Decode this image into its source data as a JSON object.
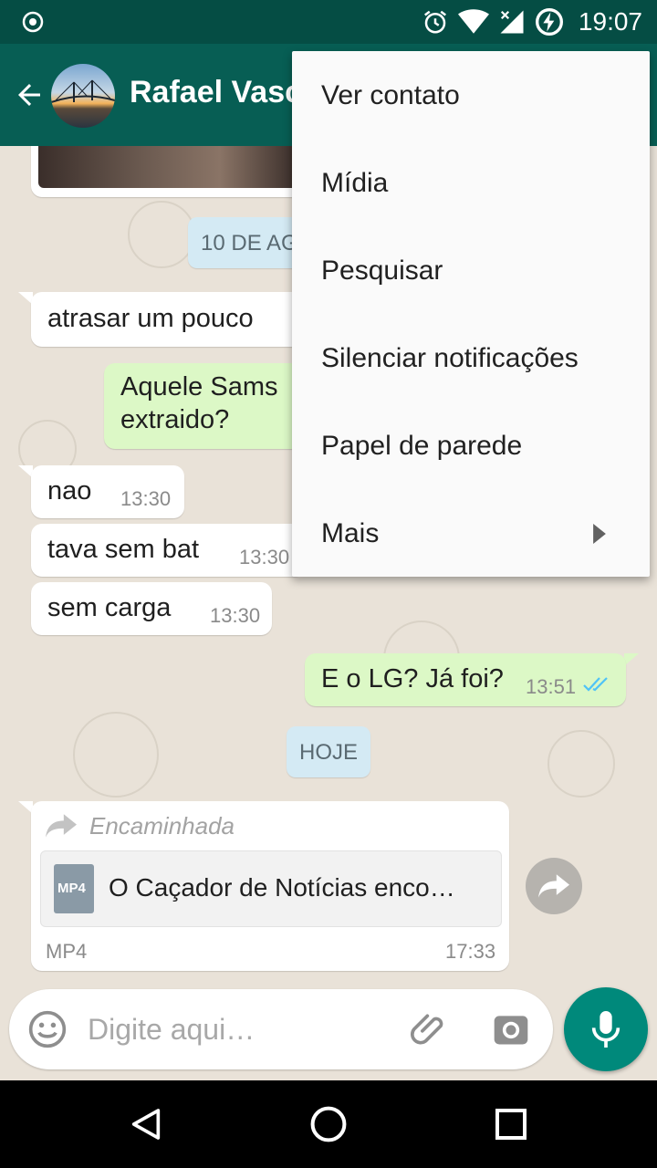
{
  "status_bar": {
    "time": "19:07"
  },
  "header": {
    "contact_name": "Rafael Vasc"
  },
  "messages": {
    "date_1": "10 DE AG",
    "m1_text": "atrasar um pouco",
    "m2_line1": "Aquele Sams",
    "m2_line2": "extraido?",
    "m3_text": "nao",
    "m3_time": "13:30",
    "m4_text": "tava sem bat",
    "m4_time": "13:30",
    "m5_text": "sem carga",
    "m5_time": "13:30",
    "m6_text": "E o LG? Já foi?",
    "m6_time": "13:51",
    "date_2": "HOJE",
    "forward_label": "Encaminhada",
    "file_icon_label": "MP4",
    "file_name": "O Caçador de Notícias enco…",
    "file_type": "MP4",
    "file_time": "17:33"
  },
  "composer": {
    "placeholder": "Digite aqui…"
  },
  "menu": {
    "items": [
      {
        "label": "Ver contato"
      },
      {
        "label": "Mídia"
      },
      {
        "label": "Pesquisar"
      },
      {
        "label": "Silenciar notificações"
      },
      {
        "label": "Papel de parede"
      },
      {
        "label": "Mais"
      }
    ]
  },
  "colors": {
    "status_bar": "#054d44",
    "app_bar": "#075e54",
    "outgoing_bubble": "#dcf8c6",
    "incoming_bubble": "#ffffff",
    "accent": "#00897b",
    "read_ticks": "#4fc3f7"
  },
  "icons": [
    "record-icon",
    "alarm-icon",
    "wifi-icon",
    "signal-icon",
    "battery-charging-icon",
    "back-arrow-icon",
    "forward-icon",
    "mp4-file-icon",
    "share-icon",
    "emoji-icon",
    "attach-icon",
    "camera-icon",
    "mic-icon",
    "submenu-arrow-icon",
    "nav-back-icon",
    "nav-home-icon",
    "nav-recents-icon"
  ]
}
